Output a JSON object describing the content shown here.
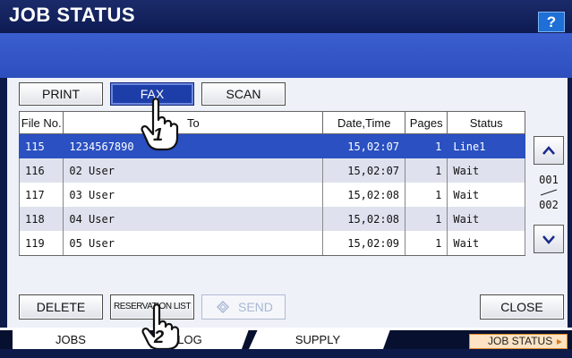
{
  "title": "JOB STATUS",
  "help_label": "?",
  "category_tabs": [
    "PRINT",
    "FAX",
    "SCAN"
  ],
  "selected_category": "FAX",
  "columns": [
    "File No.",
    "To",
    "Date,Time",
    "Pages",
    "Status"
  ],
  "rows": [
    {
      "file_no": "115",
      "to": "1234567890",
      "datetime": "15,02:07",
      "pages": "1",
      "status": "Line1"
    },
    {
      "file_no": "116",
      "to": "02 User",
      "datetime": "15,02:07",
      "pages": "1",
      "status": "Wait"
    },
    {
      "file_no": "117",
      "to": "03 User",
      "datetime": "15,02:08",
      "pages": "1",
      "status": "Wait"
    },
    {
      "file_no": "118",
      "to": "04 User",
      "datetime": "15,02:08",
      "pages": "1",
      "status": "Wait"
    },
    {
      "file_no": "119",
      "to": "05 User",
      "datetime": "15,02:09",
      "pages": "1",
      "status": "Wait"
    }
  ],
  "page": {
    "current": "001",
    "total": "002"
  },
  "actions": {
    "delete": "DELETE",
    "reservation": "RESERVATION LIST",
    "send": "SEND",
    "close": "CLOSE"
  },
  "bottom_tabs": [
    "JOBS",
    "LOG",
    "SUPPLY"
  ],
  "job_status_button": "JOB STATUS",
  "callouts": [
    "1",
    "2"
  ],
  "icons": {
    "scroll_up": "chevron-up-icon",
    "scroll_down": "chevron-down-icon",
    "send": "diamond-icon",
    "pointer": "pointing-hand-icon"
  },
  "colors": {
    "selected": "#1d3ea8",
    "title_bg": "#0e1b52",
    "band": "#3356c8"
  }
}
